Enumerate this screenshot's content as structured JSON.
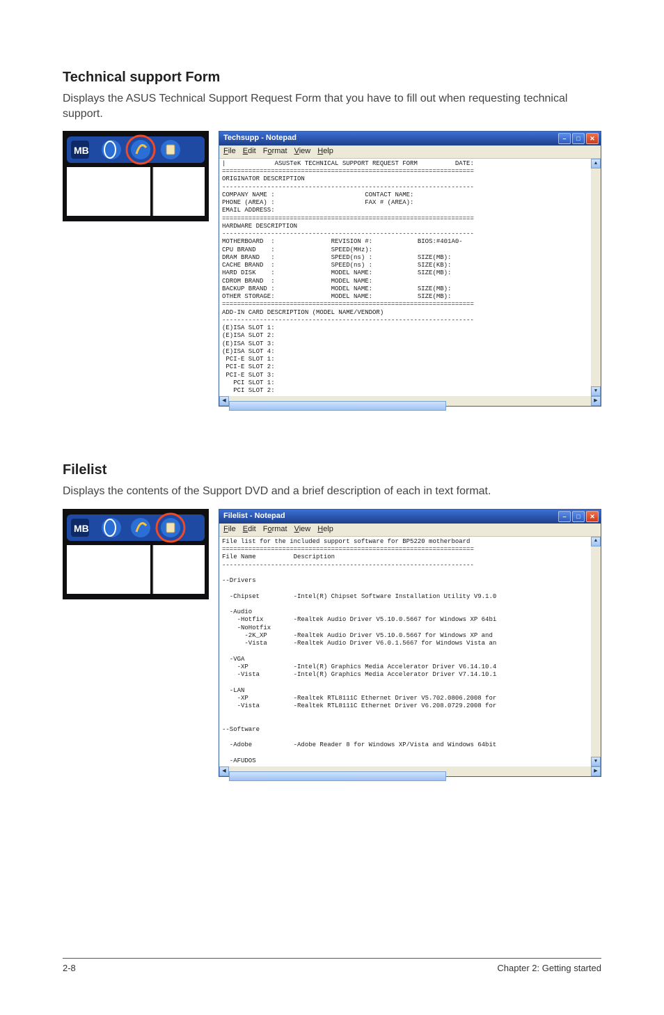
{
  "section1": {
    "heading": "Technical support Form",
    "desc": "Displays the ASUS Technical Support Request Form that you have to fill out when requesting technical support."
  },
  "section2": {
    "heading": "Filelist",
    "desc": "Displays the contents of the Support DVD and a brief description of each in text format."
  },
  "notepad1": {
    "title": "Techsupp - Notepad",
    "menus": {
      "file": "File",
      "edit": "Edit",
      "format": "Format",
      "view": "View",
      "help": "Help"
    },
    "body": "|             ASUSTeK TECHNICAL SUPPORT REQUEST FORM          DATE:\n===================================================================\nORIGINATOR DESCRIPTION\n-------------------------------------------------------------------\nCOMPANY NAME :                        CONTACT NAME:\nPHONE (AREA) :                        FAX # (AREA):\nEMAIL ADDRESS:\n===================================================================\nHARDWARE DESCRIPTION\n-------------------------------------------------------------------\nMOTHERBOARD  :               REVISION #:            BIOS:#401A0-\nCPU BRAND    :               SPEED(MHz):\nDRAM BRAND   :               SPEED(ns) :            SIZE(MB):\nCACHE BRAND  :               SPEED(ns) :            SIZE(KB):\nHARD DISK    :               MODEL NAME:            SIZE(MB):\nCDROM BRAND  :               MODEL NAME:\nBACKUP BRAND :               MODEL NAME:            SIZE(MB):\nOTHER STORAGE:               MODEL NAME:            SIZE(MB):\n===================================================================\nADD-IN CARD DESCRIPTION (MODEL NAME/VENDOR)\n-------------------------------------------------------------------\n(E)ISA SLOT 1:\n(E)ISA SLOT 2:\n(E)ISA SLOT 3:\n(E)ISA SLOT 4:\n PCI-E SLOT 1:\n PCI-E SLOT 2:\n PCI-E SLOT 3:\n   PCI SLOT 1:\n   PCI SLOT 2:"
  },
  "notepad2": {
    "title": "Filelist - Notepad",
    "menus": {
      "file": "File",
      "edit": "Edit",
      "format": "Format",
      "view": "View",
      "help": "Help"
    },
    "body": "File list for the included support software for BP5220 motherboard\n===================================================================\nFile Name          Description\n-------------------------------------------------------------------\n\n--Drivers\n\n  -Chipset         -Intel(R) Chipset Software Installation Utility V9.1.0\n\n  -Audio\n    -Hotfix        -Realtek Audio Driver V5.10.0.5667 for Windows XP 64bi\n    -NoHotfix\n      -2K_XP       -Realtek Audio Driver V5.10.0.5667 for Windows XP and\n      -Vista       -Realtek Audio Driver V6.0.1.5667 for Windows Vista an\n\n  -VGA\n    -XP            -Intel(R) Graphics Media Accelerator Driver V6.14.10.4\n    -Vista         -Intel(R) Graphics Media Accelerator Driver V7.14.10.1\n\n  -LAN\n    -XP            -Realtek RTL8111C Ethernet Driver V5.702.0806.2008 for\n    -Vista         -Realtek RTL8111C Ethernet Driver V6.208.0729.2008 for\n\n\n--Software\n\n  -Adobe           -Adobe Reader 8 for Windows XP/Vista and Windows 64bit\n\n  -AFUDOS"
  },
  "footer": {
    "left": "2-8",
    "right": "Chapter 2: Getting started"
  }
}
